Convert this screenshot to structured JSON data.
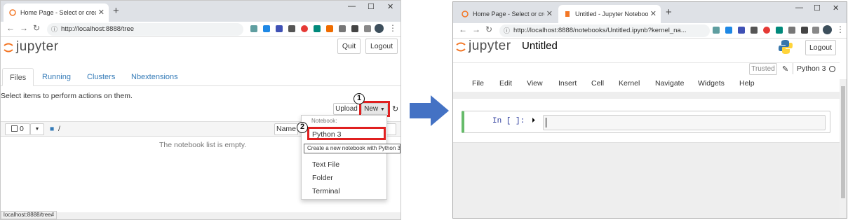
{
  "left_window": {
    "tab_title": "Home Page - Select or create a",
    "url": "http://localhost:8888/tree",
    "logo_text": "jupyter",
    "quit_label": "Quit",
    "logout_label": "Logout",
    "tabs": [
      "Files",
      "Running",
      "Clusters",
      "Nbextensions"
    ],
    "select_hint": "Select items to perform actions on them.",
    "upload_label": "Upload",
    "new_label": "New",
    "select_count": "0",
    "breadcrumb": "/",
    "name_sort_label": "Name",
    "empty_message": "The notebook list is empty.",
    "menu": {
      "section_header": "Notebook:",
      "python_label": "Python 3",
      "tooltip": "Create a new notebook with Python 3",
      "text_file": "Text File",
      "folder": "Folder",
      "terminal": "Terminal"
    },
    "status_url": "localhost:8888/tree#",
    "callouts": [
      "1",
      "2"
    ]
  },
  "right_window": {
    "tab1_title": "Home Page - Select or create a",
    "tab2_title": "Untitled - Jupyter Notebook",
    "url": "http://localhost:8888/notebooks/Untitled.ipynb?kernel_na...",
    "logo_text": "jupyter",
    "notebook_name": "Untitled",
    "logout_label": "Logout",
    "trusted_label": "Trusted",
    "kernel_name": "Python 3",
    "menus": [
      "File",
      "Edit",
      "View",
      "Insert",
      "Cell",
      "Kernel",
      "Navigate",
      "Widgets",
      "Help"
    ],
    "cell_prompt": "In [ ]:"
  },
  "colors": {
    "accent_red": "#e02020",
    "jupyter_orange": "#f37726",
    "arrow_blue": "#4472c4",
    "link_blue": "#337ab7",
    "cell_green": "#66bb6a"
  }
}
